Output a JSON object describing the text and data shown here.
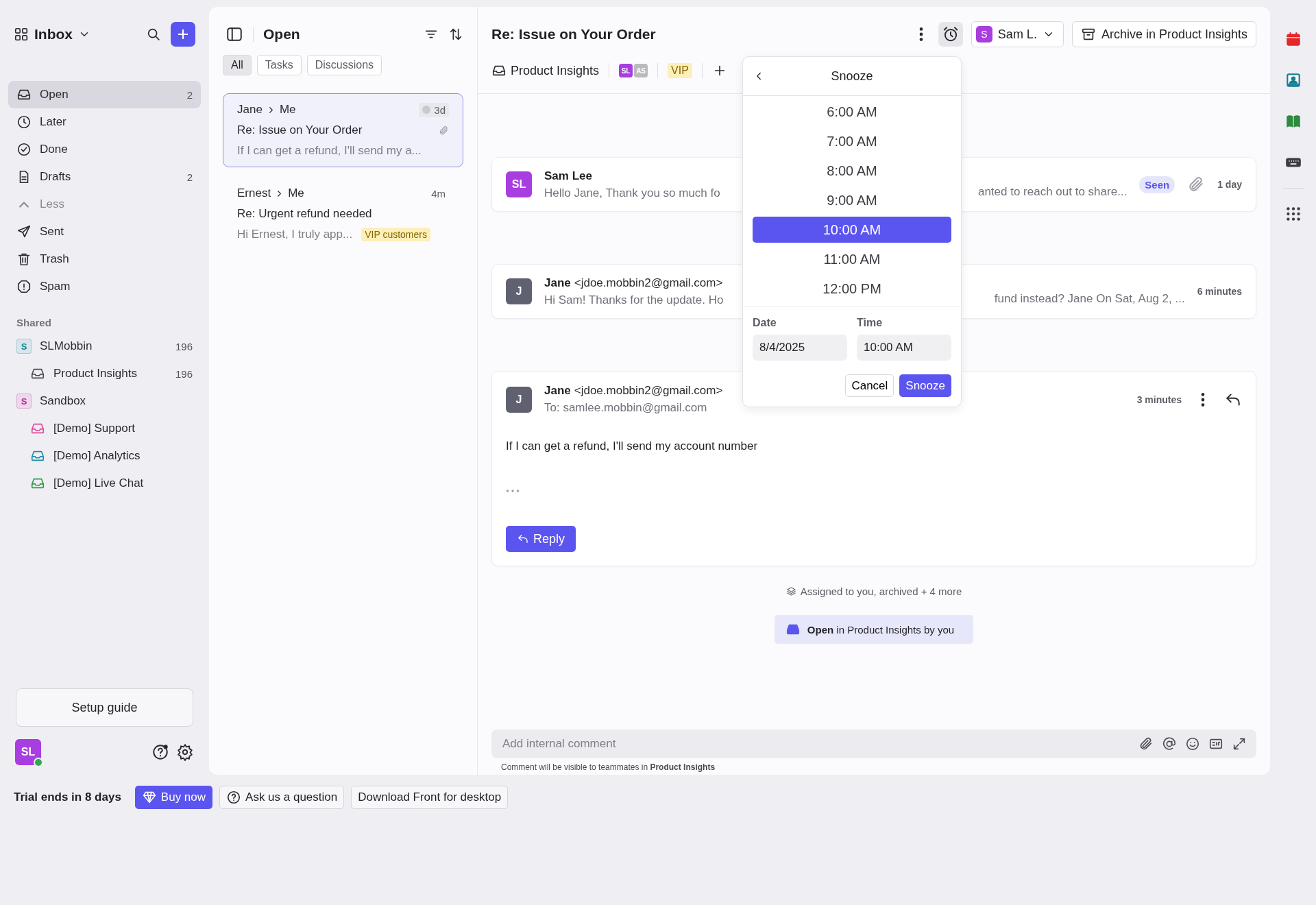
{
  "sidebar": {
    "title": "Inbox",
    "nav": [
      {
        "label": "Open",
        "count": "2",
        "selected": true,
        "kind": "inbox"
      },
      {
        "label": "Later",
        "selected": false,
        "kind": "clock"
      },
      {
        "label": "Done",
        "selected": false,
        "kind": "check"
      },
      {
        "label": "Drafts",
        "count": "2",
        "selected": false,
        "kind": "draft"
      },
      {
        "label": "Less",
        "selected": false,
        "kind": "less"
      },
      {
        "label": "Sent",
        "selected": false,
        "kind": "sent"
      },
      {
        "label": "Trash",
        "selected": false,
        "kind": "trash"
      },
      {
        "label": "Spam",
        "selected": false,
        "kind": "spam"
      }
    ],
    "shared_label": "Shared",
    "shared": [
      {
        "initial": "S",
        "name": "SLMobbin",
        "count": "196",
        "color": "#0e8a9e",
        "children": [
          {
            "name": "Product Insights",
            "count": "196",
            "color": "#4b4b55"
          }
        ]
      },
      {
        "initial": "S",
        "name": "Sandbox",
        "color": "#c4259b",
        "children": [
          {
            "name": "[Demo] Support",
            "color": "#e0479e"
          },
          {
            "name": "[Demo] Analytics",
            "color": "#1a8ea6"
          },
          {
            "name": "[Demo] Live Chat",
            "color": "#2f9a4a"
          }
        ]
      }
    ],
    "setup_button": "Setup guide",
    "avatar": "SL"
  },
  "list": {
    "title": "Open",
    "filters": [
      {
        "label": "All",
        "selected": true
      },
      {
        "label": "Tasks",
        "selected": false
      },
      {
        "label": "Discussions",
        "selected": false
      }
    ],
    "items": [
      {
        "from": "Jane",
        "to": "Me",
        "time": "3d",
        "subject": "Re: Issue on Your Order",
        "preview": "If I can get a refund, I'll send my a...",
        "attachment": true,
        "selected": true
      },
      {
        "from": "Ernest",
        "to": "Me",
        "time": "4m",
        "subject": "Re: Urgent refund needed",
        "preview": "Hi Ernest, I truly app...",
        "tag": "VIP customers",
        "attachment": false,
        "selected": false
      }
    ]
  },
  "conversation": {
    "title": "Re: Issue on Your Order",
    "assignee_initial": "S",
    "assignee": "Sam L.",
    "archive_button": "Archive in Product Insights",
    "inbox": "Product Insights",
    "participants": [
      "SL",
      "AS"
    ],
    "tag": "VIP",
    "messages": [
      {
        "initials": "SL",
        "color": "#a83de0",
        "sender": "Sam Lee",
        "preview_start": "Hello Jane, Thank you so much fo",
        "preview_end": "anted to reach out to share...",
        "badge": "Seen",
        "attachment": true,
        "time": "1 day"
      },
      {
        "initials": "J",
        "color": "#5f6170",
        "sender": "Jane",
        "email": "<jdoe.mobbin2@gmail.com>",
        "preview_start": "Hi Sam! Thanks for the update. Ho",
        "preview_end": "fund instead? Jane On Sat, Aug 2, ...",
        "time": "6 minutes"
      },
      {
        "initials": "J",
        "color": "#5f6170",
        "sender": "Jane",
        "email": "<jdoe.mobbin2@gmail.com>",
        "to": "To: samlee.mobbin@gmail.com",
        "time": "3 minutes",
        "body": "If I can get a refund, I'll send my account number",
        "reply": "Reply"
      }
    ],
    "activity": "Assigned to you, archived + 4 more",
    "status": "**Open** in Product Insights by you",
    "comment_placeholder": "Add internal comment",
    "comment_note": "Comment will be visible to teammates in **Product Insights**"
  },
  "snooze": {
    "title": "Snooze",
    "times": [
      {
        "label": "6:00 AM",
        "selected": false
      },
      {
        "label": "7:00 AM",
        "selected": false
      },
      {
        "label": "8:00 AM",
        "selected": false
      },
      {
        "label": "9:00 AM",
        "selected": false
      },
      {
        "label": "10:00 AM",
        "selected": true
      },
      {
        "label": "11:00 AM",
        "selected": false
      },
      {
        "label": "12:00 PM",
        "selected": false
      }
    ],
    "date_label": "Date",
    "date": "8/4/2025",
    "time_label": "Time",
    "time": "10:00 AM",
    "cancel": "Cancel",
    "confirm": "Snooze"
  },
  "footer": {
    "trial": "Trial ends in 8 days",
    "buy": "Buy now",
    "ask": "Ask us a question",
    "download": "Download Front for desktop"
  }
}
